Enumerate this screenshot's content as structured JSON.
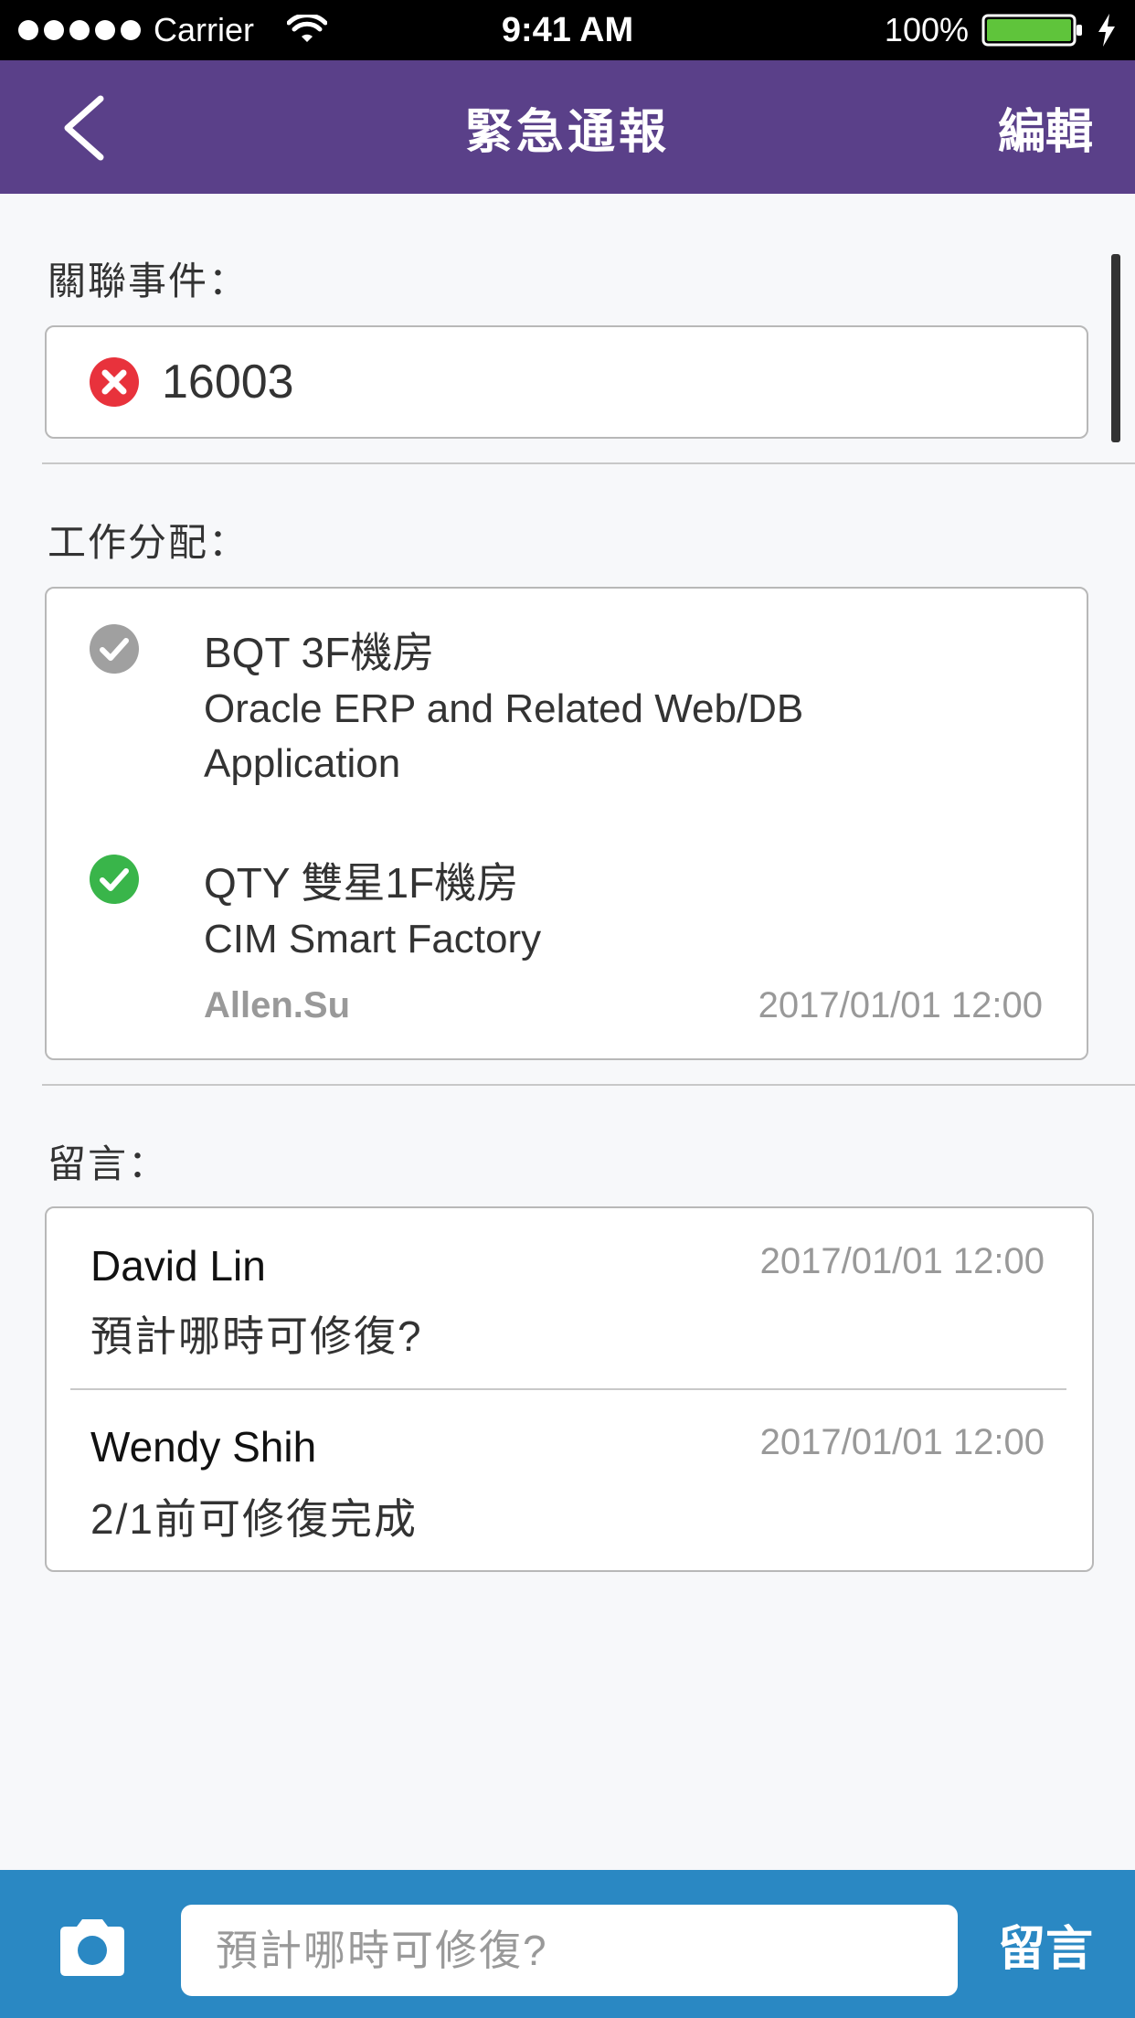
{
  "status_bar": {
    "carrier": "Carrier",
    "time": "9:41 AM",
    "battery": "100%",
    "icons": [
      "signal-icon",
      "wifi-icon",
      "battery-icon",
      "charging-bolt-icon"
    ]
  },
  "nav": {
    "title": "緊急通報",
    "edit_label": "編輯",
    "back_icon": "chevron-left-icon"
  },
  "related_event": {
    "label": "關聯事件：",
    "number": "16003",
    "icon": "error-x-icon"
  },
  "assignment": {
    "label": "工作分配：",
    "tasks": [
      {
        "title": "BQT 3F機房",
        "description": [
          "Oracle ERP and Related Web/DB",
          "Application"
        ],
        "status_icon": "check-circle-gray-icon"
      },
      {
        "title": "QTY 雙星1F機房",
        "description": [
          "CIM Smart Factory"
        ],
        "status_icon": "check-circle-green-icon",
        "user": "Allen.Su",
        "time": "2017/01/01 12:00"
      }
    ]
  },
  "comments": {
    "label": "留言：",
    "items": [
      {
        "name": "David Lin",
        "time": "2017/01/01 12:00",
        "text": "預計哪時可修復?"
      },
      {
        "name": "Wendy Shih",
        "time": "2017/01/01 12:00",
        "text": "2/1前可修復完成"
      }
    ]
  },
  "composer": {
    "placeholder": "預計哪時可修復?",
    "send_label": "留言",
    "camera_icon": "camera-icon"
  },
  "colors": {
    "nav_bg": "#5a4089",
    "bottom_bar_bg": "#2a88c3",
    "error_red": "#e8323c",
    "check_gray": "#a0a0a0",
    "check_green": "#39b54a"
  }
}
